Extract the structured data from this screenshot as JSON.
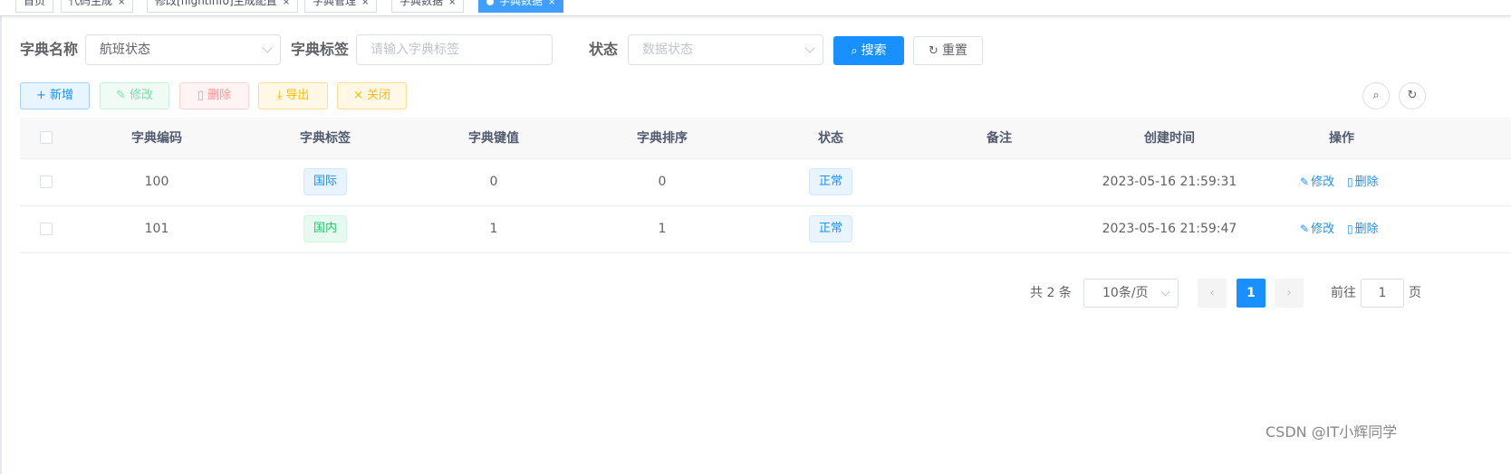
{
  "tags": [
    {
      "label": "首页"
    },
    {
      "label": "代码生成"
    },
    {
      "label": "修改[flightinfo]生成配置"
    },
    {
      "label": "字典管理"
    },
    {
      "label": "字典数据"
    },
    {
      "label": "字典数据",
      "active": true
    }
  ],
  "search": {
    "dict_name_label": "字典名称",
    "dict_name_value": "航班状态",
    "dict_label_label": "字典标签",
    "dict_label_placeholder": "请输入字典标签",
    "status_label": "状态",
    "status_placeholder": "数据状态",
    "search_btn": "搜索",
    "reset_btn": "重置"
  },
  "toolbar": {
    "add": "新增",
    "edit": "修改",
    "delete": "删除",
    "export": "导出",
    "close": "关闭"
  },
  "table": {
    "columns": [
      "字典编码",
      "字典标签",
      "字典键值",
      "字典排序",
      "状态",
      "备注",
      "创建时间",
      "操作"
    ],
    "rows": [
      {
        "code": "100",
        "label": "国际",
        "label_style": "blue",
        "value": "0",
        "sort": "0",
        "status": "正常",
        "remark": "",
        "created": "2023-05-16 21:59:31",
        "edit": "修改",
        "delete": "删除"
      },
      {
        "code": "101",
        "label": "国内",
        "label_style": "green",
        "value": "1",
        "sort": "1",
        "status": "正常",
        "remark": "",
        "created": "2023-05-16 21:59:47",
        "edit": "修改",
        "delete": "删除"
      }
    ]
  },
  "pagination": {
    "total_text": "共 2 条",
    "page_size": "10条/页",
    "current_page": "1",
    "goto_prefix": "前往",
    "goto_value": "1",
    "goto_suffix": "页"
  },
  "watermark": "CSDN @IT小辉同学",
  "colors": {
    "primary": "#1890ff",
    "success": "#13ce66",
    "danger": "#ff4949",
    "warning": "#ffba00"
  }
}
